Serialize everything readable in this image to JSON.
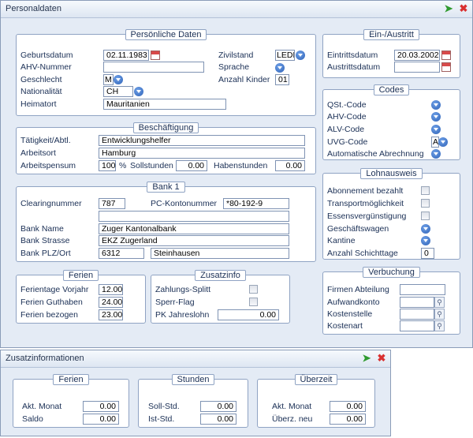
{
  "main_window": {
    "title": "Personaldaten",
    "personal": {
      "caption": "Persönliche Daten",
      "birthdate_label": "Geburtsdatum",
      "birthdate": "02.11.1983",
      "ahv_label": "AHV-Nummer",
      "ahv": "",
      "gender_label": "Geschlecht",
      "gender": "M",
      "nationality_label": "Nationalität",
      "nationality": "CH",
      "hometown_label": "Heimatort",
      "hometown": "Mauritanien",
      "civil_label": "Zivilstand",
      "civil": "LEDI",
      "language_label": "Sprache",
      "children_label": "Anzahl Kinder",
      "children": "01"
    },
    "employment_period": {
      "caption": "Ein-/Austritt",
      "entry_label": "Eintrittsdatum",
      "entry": "20.03.2002",
      "exit_label": "Austrittsdatum",
      "exit": ""
    },
    "codes": {
      "caption": "Codes",
      "qst_label": "QSt.-Code",
      "ahv_label": "AHV-Code",
      "alv_label": "ALV-Code",
      "uvg_label": "UVG-Code",
      "uvg": "A",
      "auto_label": "Automatische Abrechnung"
    },
    "job": {
      "caption": "Beschäftigung",
      "activity_label": "Tätigkeit/Abtl.",
      "activity": "Entwicklungshelfer",
      "workplace_label": "Arbeitsort",
      "workplace": "Hamburg",
      "workload_label": "Arbeitspensum",
      "workload": "100",
      "percent": "%",
      "target_hours_label": "Sollstunden",
      "target_hours": "0.00",
      "credit_hours_label": "Habenstunden",
      "credit_hours": "0.00"
    },
    "bank": {
      "caption": "Bank 1",
      "clearing_label": "Clearingnummer",
      "clearing": "787",
      "pc_label": "PC-Kontonummer",
      "pc": "*80-192-9",
      "extra": "",
      "name_label": "Bank Name",
      "name": "Zuger Kantonalbank",
      "street_label": "Bank Strasse",
      "street": "EKZ Zugerland",
      "plz_label": "Bank PLZ/Ort",
      "plz": "6312",
      "city": "Steinhausen"
    },
    "salary_cert": {
      "caption": "Lohnausweis",
      "subscription_label": "Abonnement bezahlt",
      "transport_label": "Transportmöglichkeit",
      "meal_label": "Essensvergünstigung",
      "car_label": "Geschäftswagen",
      "canteen_label": "Kantine",
      "shifts_label": "Anzahl Schichttage",
      "shifts": "0"
    },
    "holidays": {
      "caption": "Ferien",
      "prev_label": "Ferientage Vorjahr",
      "prev": "12.00",
      "credit_label": "Ferien Guthaben",
      "credit": "24.00",
      "taken_label": "Ferien bezogen",
      "taken": "23.00"
    },
    "extra": {
      "caption": "Zusatzinfo",
      "split_label": "Zahlungs-Splitt",
      "lock_label": "Sperr-Flag",
      "pk_label": "PK Jahreslohn",
      "pk": "0.00"
    },
    "booking": {
      "caption": "Verbuchung",
      "dept_label": "Firmen Abteilung",
      "dept": "",
      "expense_label": "Aufwandkonto",
      "expense": "",
      "cost_center_label": "Kostenstelle",
      "cost_center": "",
      "cost_type_label": "Kostenart",
      "cost_type": ""
    }
  },
  "second_window": {
    "title": "Zusatzinformationen",
    "holidays": {
      "caption": "Ferien",
      "month_label": "Akt. Monat",
      "month": "0.00",
      "balance_label": "Saldo",
      "balance": "0.00"
    },
    "hours": {
      "caption": "Stunden",
      "target_label": "Soll-Std.",
      "target": "0.00",
      "actual_label": "Ist-Std.",
      "actual": "0.00"
    },
    "overtime": {
      "caption": "Überzeit",
      "month_label": "Akt. Monat",
      "month": "0.00",
      "new_label": "Überz. neu",
      "new": "0.00"
    }
  },
  "icons": {
    "ok": "green-check-arrow-icon",
    "close": "red-x-icon"
  },
  "colors": {
    "frame": "#e4ebf5",
    "group_border": "#8fa3c3",
    "label_text": "#1a2f55"
  }
}
